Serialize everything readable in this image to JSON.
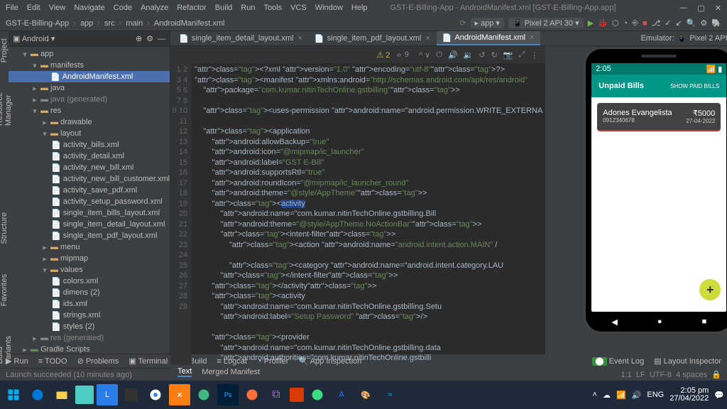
{
  "window": {
    "title": "GST-E-Billing-App - AndroidManifest.xml [GST-E-Billing-App.app]",
    "menus": [
      "File",
      "Edit",
      "View",
      "Navigate",
      "Code",
      "Analyze",
      "Refactor",
      "Build",
      "Run",
      "Tools",
      "VCS",
      "Window",
      "Help"
    ]
  },
  "breadcrumb": [
    "GST-E-Billing-App",
    "app",
    "src",
    "main",
    "AndroidManifest.xml"
  ],
  "runconfig": {
    "app": "app",
    "device": "Pixel 2 API 30"
  },
  "sidebar": {
    "title": "Android",
    "tree": {
      "app": "app",
      "manifests": "manifests",
      "manifest_file": "AndroidManifest.xml",
      "java": "java",
      "java_gen": "java (generated)",
      "res": "res",
      "drawable": "drawable",
      "layout": "layout",
      "layouts": [
        "activity_bills.xml",
        "activity_detail.xml",
        "activity_new_bill.xml",
        "activity_new_bill_customer.xml",
        "activity_save_pdf.xml",
        "activity_setup_password.xml",
        "single_item_bills_layout.xml",
        "single_item_detail_layout.xml",
        "single_item_pdf_layout.xml"
      ],
      "menu": "menu",
      "mipmap": "mipmap",
      "values": "values",
      "values_items": [
        "colors.xml",
        "dimens (2)",
        "ids.xml",
        "strings.xml",
        "styles (2)"
      ],
      "res_gen": "res (generated)",
      "gradle": "Gradle Scripts"
    }
  },
  "editor_tabs": [
    {
      "label": "single_item_detail_layout.xml",
      "active": false
    },
    {
      "label": "single_item_pdf_layout.xml",
      "active": false
    },
    {
      "label": "AndroidManifest.xml",
      "active": true
    }
  ],
  "emulator_tab": {
    "label": "Emulator:",
    "device": "Pixel 2 API 30"
  },
  "editor_status": {
    "warn": "2",
    "weak": "9"
  },
  "code_lines": [
    "<?xml version=\"1.0\" encoding=\"utf-8\"?>",
    "<manifest xmlns:android=\"http://schemas.android.com/apk/res/android\"",
    "    package=\"com.kumar.nitinTechOnline.gstbilling\">",
    "",
    "    <uses-permission android:name=\"android.permission.WRITE_EXTERNA",
    "",
    "    <application",
    "        android:allowBackup=\"true\"",
    "        android:icon=\"@mipmap/ic_launcher\"",
    "        android:label=\"GST E-Bill\"",
    "        android:supportsRtl=\"true\"",
    "        android:roundIcon=\"@mipmap/ic_launcher_round\"",
    "        android:theme=\"@style/AppTheme\">",
    "        <activity",
    "            android:name=\"com.kumar.nitinTechOnline.gstbilling.Bill",
    "            android:theme=\"@style/AppTheme.NoActionBar\">",
    "            <intent-filter>",
    "                <action android:name=\"android.intent.action.MAIN\" /",
    "",
    "                <category android:name=\"android.intent.category.LAU",
    "            </intent-filter>",
    "        </activity>",
    "        <activity",
    "            android:name=\"com.kumar.nitinTechOnline.gstbilling.Setu",
    "            android:label=\"Setup Password\" />",
    "",
    "        <provider",
    "            android:name=\"com.kumar.nitinTechOnline.gstbilling.data",
    "            android:authorities=\"com.kumar.nitinTechOnline.gstbilli"
  ],
  "bottom_code_tabs": [
    "Text",
    "Merged Manifest"
  ],
  "emulator_app": {
    "time": "2:05",
    "title": "Unpaid Bills",
    "action": "SHOW PAID BILLS",
    "card": {
      "name": "Adones Evangelista",
      "phone": "0912340678",
      "amount": "₹5000",
      "date": "27-04-2022"
    }
  },
  "bottombar": {
    "items": [
      "Run",
      "TODO",
      "Problems",
      "Terminal",
      "Build",
      "Logcat",
      "Profiler",
      "App Inspection"
    ],
    "eventlog": "Event Log",
    "layoutinsp": "Layout Inspector"
  },
  "statusline": {
    "msg": "Launch succeeded (10 minutes ago)",
    "pos": "1:1",
    "lf": "LF",
    "enc": "UTF-8",
    "spaces": "4 spaces"
  },
  "tray": {
    "lang": "ENG",
    "time": "2:05 pm",
    "date": "27/04/2022"
  }
}
